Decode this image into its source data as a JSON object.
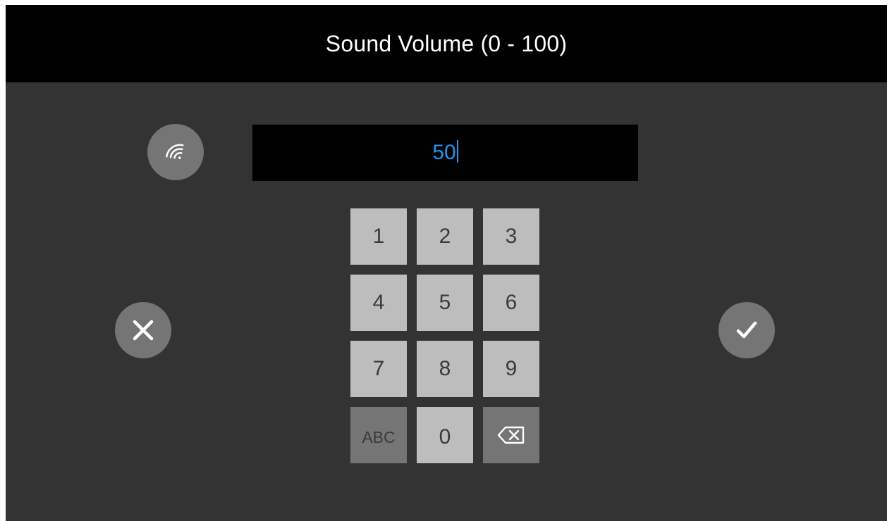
{
  "header": {
    "title": "Sound Volume (0 - 100)"
  },
  "input": {
    "value": "50"
  },
  "keypad": {
    "keys": [
      "1",
      "2",
      "3",
      "4",
      "5",
      "6",
      "7",
      "8",
      "9",
      "ABC",
      "0"
    ],
    "backspace_icon": "backspace-icon"
  },
  "icons": {
    "nfc": "nfc-icon",
    "cancel": "close-icon",
    "confirm": "checkmark-icon"
  },
  "colors": {
    "header_background": "#000000",
    "screen_background": "#333333",
    "input_text": "#2196f3",
    "key_light": "#bdbdbd",
    "key_dark": "#757575",
    "circle_button": "#757575"
  }
}
